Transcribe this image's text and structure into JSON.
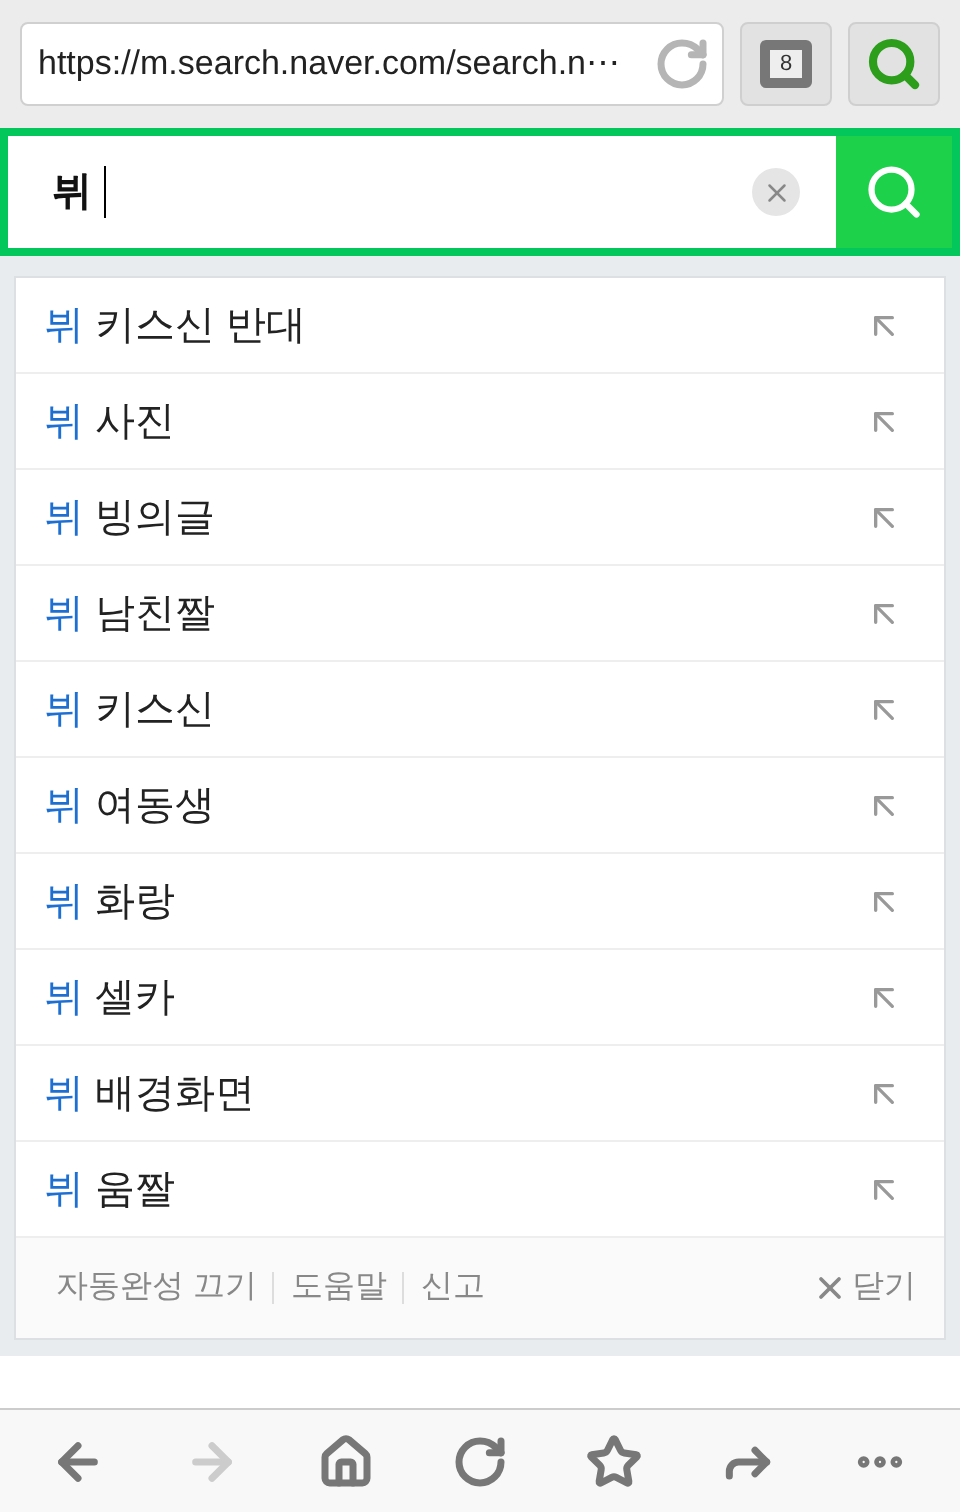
{
  "address_bar": {
    "url": "https://m.search.naver.com/search.n⋯",
    "tab_count": "8"
  },
  "search": {
    "value": "뷔"
  },
  "suggestions": [
    {
      "match": "뷔",
      "completion": "키스신 반대"
    },
    {
      "match": "뷔",
      "completion": "사진"
    },
    {
      "match": "뷔",
      "completion": "빙의글"
    },
    {
      "match": "뷔",
      "completion": "남친짤"
    },
    {
      "match": "뷔",
      "completion": "키스신"
    },
    {
      "match": "뷔",
      "completion": "여동생"
    },
    {
      "match": "뷔",
      "completion": "화랑"
    },
    {
      "match": "뷔",
      "completion": "셀카"
    },
    {
      "match": "뷔",
      "completion": "배경화면"
    },
    {
      "match": "뷔",
      "completion": "움짤"
    }
  ],
  "suggestion_footer": {
    "links": [
      "자동완성 끄기",
      "도움말",
      "신고"
    ],
    "close": "닫기"
  },
  "toolbar": [
    {
      "kind": "back",
      "disabled": false
    },
    {
      "kind": "forward",
      "disabled": true
    },
    {
      "kind": "home",
      "disabled": false
    },
    {
      "kind": "reload",
      "disabled": false
    },
    {
      "kind": "bookmark",
      "disabled": false
    },
    {
      "kind": "share",
      "disabled": false
    },
    {
      "kind": "more",
      "disabled": false
    }
  ]
}
